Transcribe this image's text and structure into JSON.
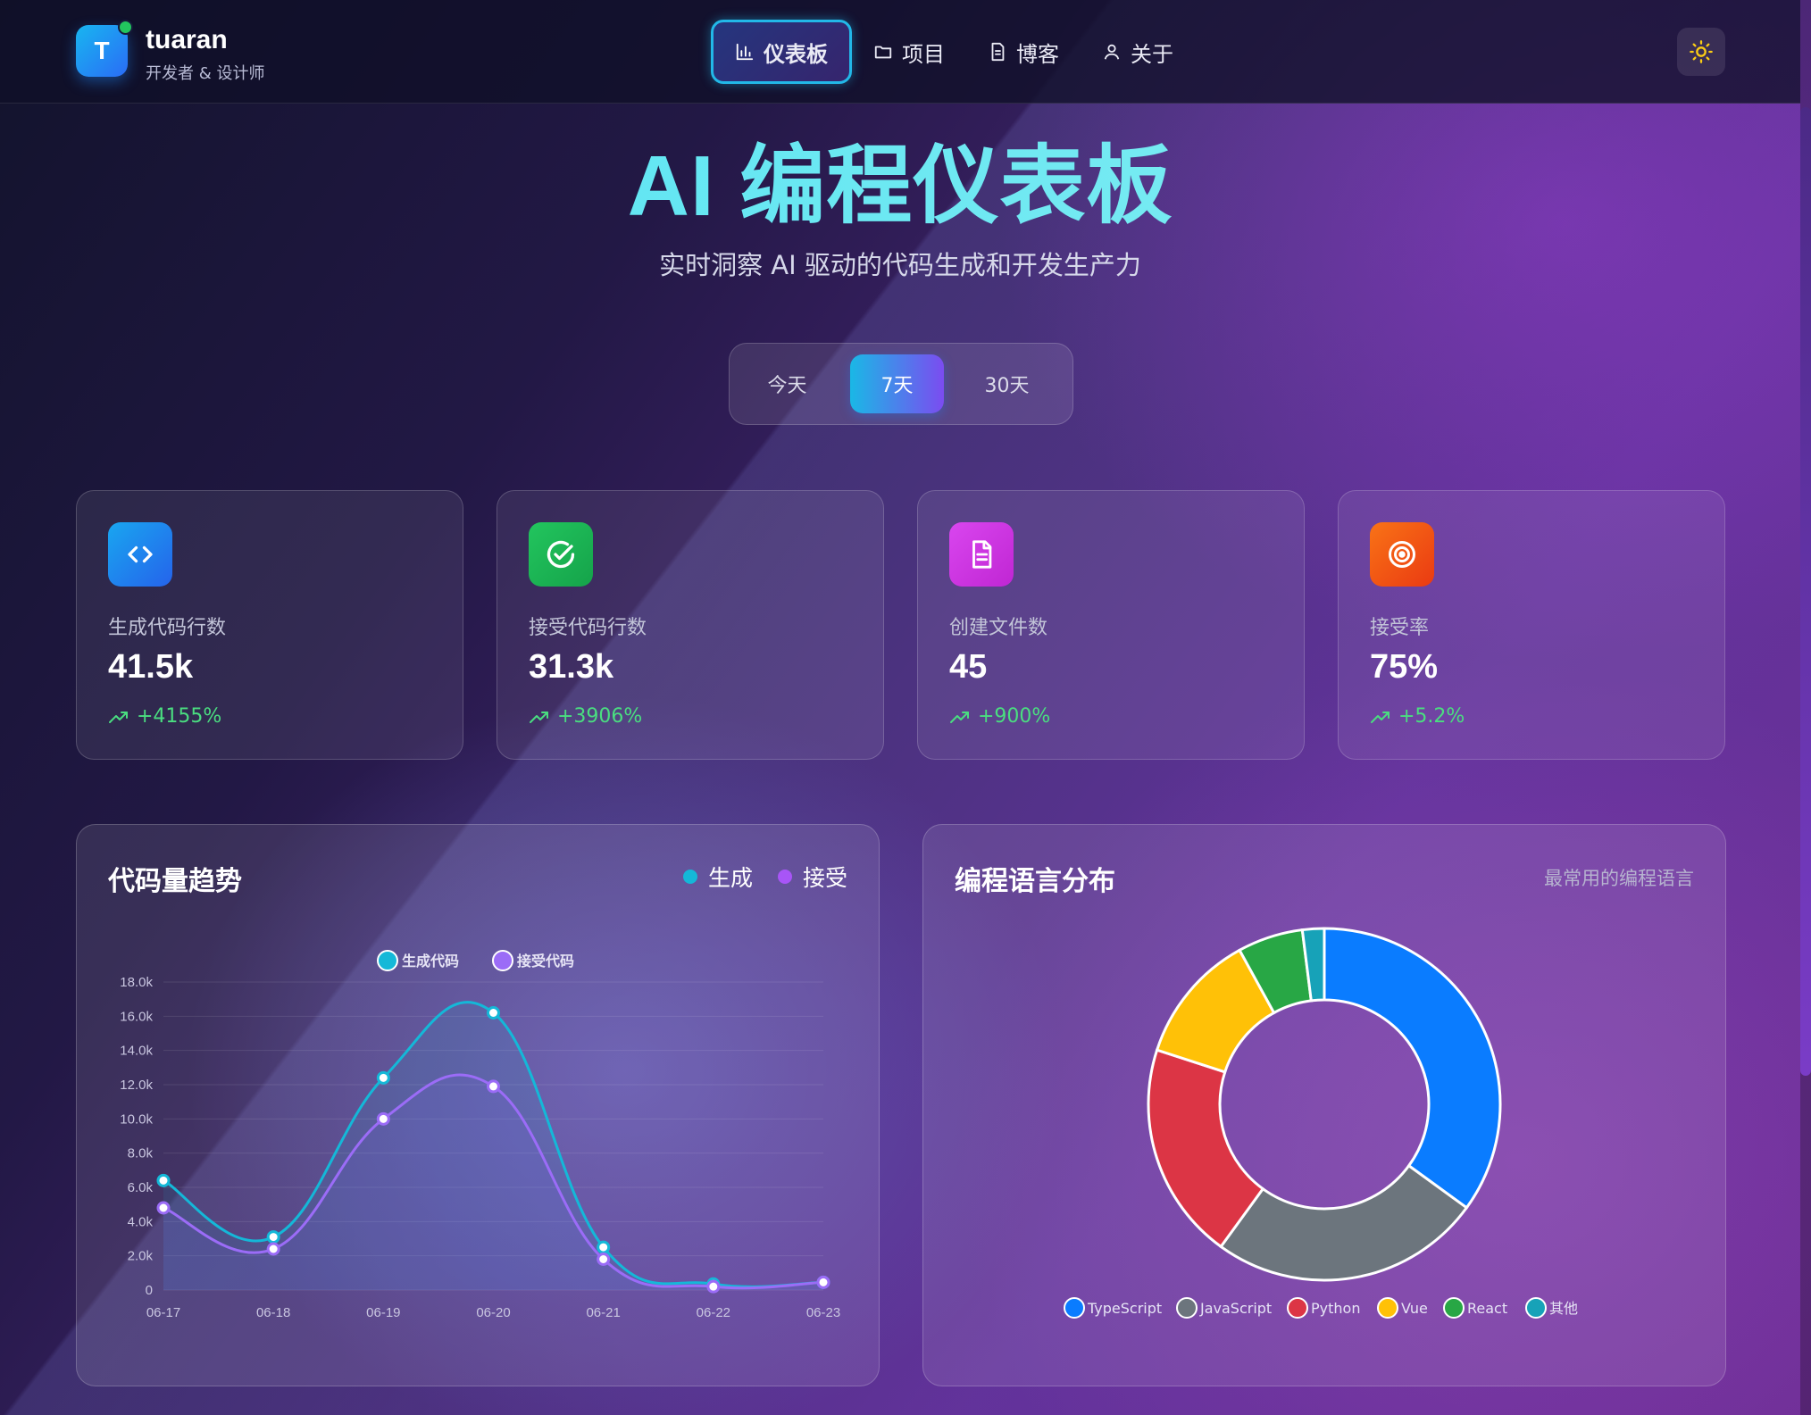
{
  "brand": {
    "logo_letter": "T",
    "name": "tuaran",
    "subtitle": "开发者 & 设计师"
  },
  "nav": [
    {
      "label": "仪表板",
      "icon": "bar-chart-icon",
      "active": true
    },
    {
      "label": "项目",
      "icon": "folder-icon",
      "active": false
    },
    {
      "label": "博客",
      "icon": "document-icon",
      "active": false
    },
    {
      "label": "关于",
      "icon": "user-icon",
      "active": false
    }
  ],
  "theme_toggle": {
    "icon": "sun-icon"
  },
  "hero": {
    "title": "AI 编程仪表板",
    "subtitle": "实时洞察 AI 驱动的代码生成和开发生产力"
  },
  "range_tabs": [
    {
      "label": "今天",
      "active": false
    },
    {
      "label": "7天",
      "active": true
    },
    {
      "label": "30天",
      "active": false
    }
  ],
  "stats": [
    {
      "label": "生成代码行数",
      "value": "41.5k",
      "change": "+4155%",
      "icon": "code-icon",
      "color_from": "#19a6f0",
      "color_to": "#2563eb"
    },
    {
      "label": "接受代码行数",
      "value": "31.3k",
      "change": "+3906%",
      "icon": "check-circle-icon",
      "color_from": "#22c55e",
      "color_to": "#15a34a"
    },
    {
      "label": "创建文件数",
      "value": "45",
      "change": "+900%",
      "icon": "file-icon",
      "color_from": "#d946ef",
      "color_to": "#c026d3"
    },
    {
      "label": "接受率",
      "value": "75%",
      "change": "+5.2%",
      "icon": "target-icon",
      "color_from": "#f97316",
      "color_to": "#ea3a12"
    }
  ],
  "trend_panel": {
    "title": "代码量趋势",
    "legend": [
      {
        "label": "生成",
        "color": "#14b8d8"
      },
      {
        "label": "接受",
        "color": "#a855f7"
      }
    ]
  },
  "lang_panel": {
    "title": "编程语言分布",
    "subtitle": "最常用的编程语言"
  },
  "chart_data": [
    {
      "type": "line",
      "x": [
        "06-17",
        "06-18",
        "06-19",
        "06-20",
        "06-21",
        "06-22",
        "06-23"
      ],
      "series": [
        {
          "name": "生成代码",
          "color": "#14b8d8",
          "values": [
            6400,
            3100,
            12400,
            16200,
            2500,
            350,
            450
          ]
        },
        {
          "name": "接受代码",
          "color": "#9b6cf7",
          "values": [
            4800,
            2400,
            10000,
            11900,
            1800,
            200,
            450
          ]
        }
      ],
      "ylim": [
        0,
        18000
      ],
      "yticks": [
        "0",
        "2.0k",
        "4.0k",
        "6.0k",
        "8.0k",
        "10.0k",
        "12.0k",
        "14.0k",
        "16.0k",
        "18.0k"
      ],
      "grid": true,
      "legend_position": "top-center"
    },
    {
      "type": "pie",
      "donut": true,
      "categories": [
        "TypeScript",
        "JavaScript",
        "Python",
        "Vue",
        "React",
        "其他"
      ],
      "values": [
        35,
        25,
        20,
        12,
        6,
        2
      ],
      "colors": [
        "#0a7cff",
        "#6c757d",
        "#dc3545",
        "#ffc107",
        "#28a745",
        "#17a2b8"
      ],
      "legend_position": "bottom"
    }
  ]
}
